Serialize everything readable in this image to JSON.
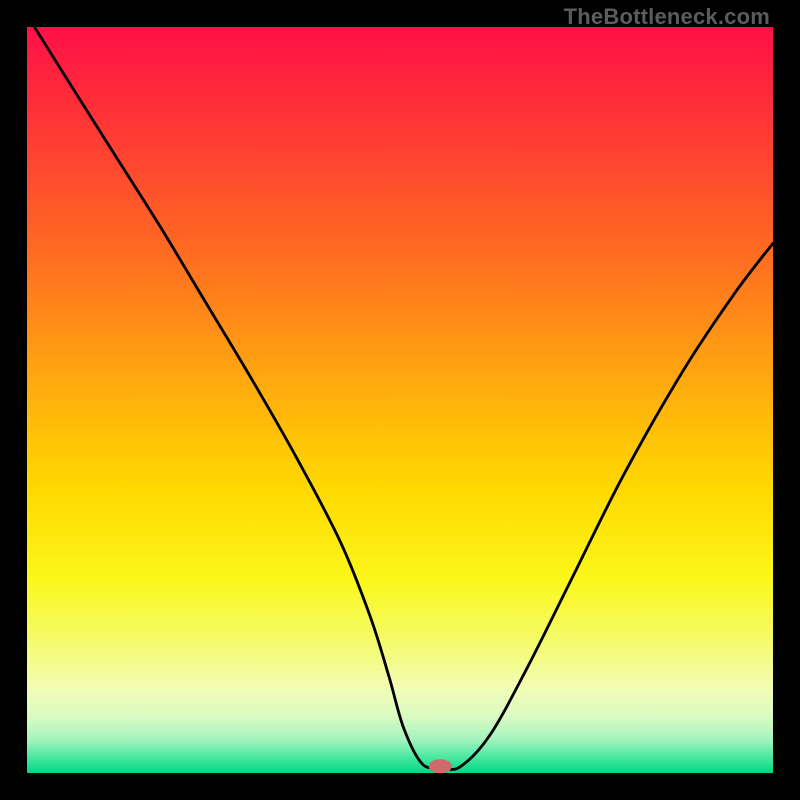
{
  "watermark": "TheBottleneck.com",
  "chart_data": {
    "type": "line",
    "title": "",
    "xlabel": "",
    "ylabel": "",
    "xlim": [
      0,
      100
    ],
    "ylim": [
      0,
      100
    ],
    "background_gradient": {
      "stops": [
        {
          "offset": 0.0,
          "color": "#ff1047"
        },
        {
          "offset": 0.12,
          "color": "#ff3337"
        },
        {
          "offset": 0.3,
          "color": "#ff6a22"
        },
        {
          "offset": 0.48,
          "color": "#ffab0e"
        },
        {
          "offset": 0.62,
          "color": "#ffd900"
        },
        {
          "offset": 0.74,
          "color": "#fbf71a"
        },
        {
          "offset": 0.82,
          "color": "#f5fb68"
        },
        {
          "offset": 0.885,
          "color": "#f3fdb4"
        },
        {
          "offset": 0.925,
          "color": "#d9fbc2"
        },
        {
          "offset": 0.955,
          "color": "#a3f4bd"
        },
        {
          "offset": 0.978,
          "color": "#4de8a2"
        },
        {
          "offset": 1.0,
          "color": "#00d884"
        }
      ]
    },
    "series": [
      {
        "name": "bottleneck-curve",
        "color": "#000000",
        "x": [
          1,
          6,
          12,
          18,
          24,
          30,
          36,
          42,
          46,
          48.5,
          50.5,
          53,
          55.5,
          58,
          62,
          67,
          73,
          80,
          88,
          95,
          100
        ],
        "y": [
          100,
          92,
          82.5,
          73,
          63,
          53,
          42.5,
          31,
          21,
          13,
          6,
          1.2,
          0.8,
          0.8,
          5,
          14,
          26,
          40,
          54,
          64.5,
          71
        ]
      }
    ],
    "marker": {
      "name": "optimum-point",
      "x": 55.4,
      "y": 0.9,
      "color": "#d06a6a",
      "rx": 1.55,
      "ry": 0.95
    }
  }
}
